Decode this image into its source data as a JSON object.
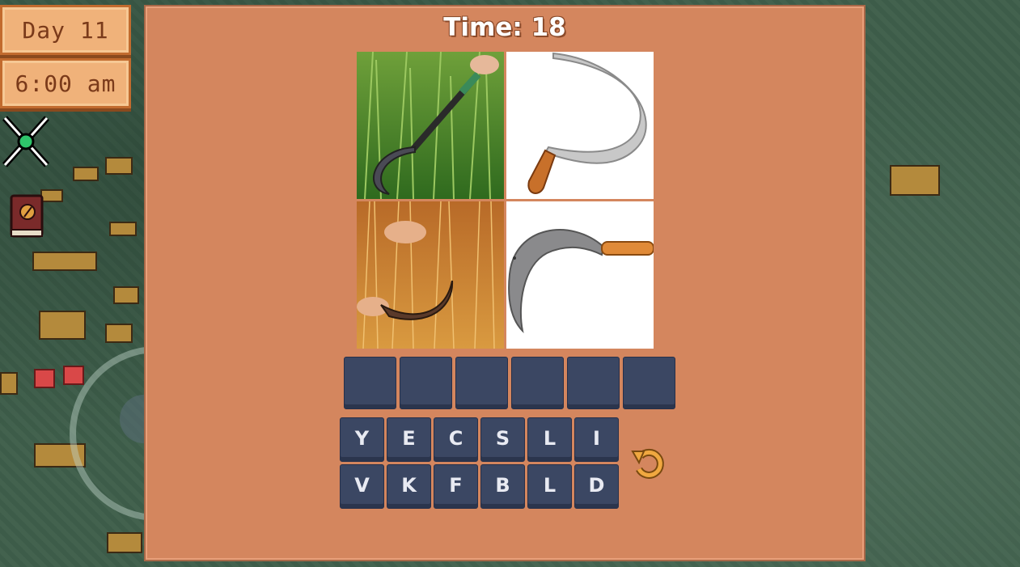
{
  "hud": {
    "day": "Day 11",
    "time": "6:00 am"
  },
  "puzzle": {
    "timer": "Time: 18",
    "answer_length": 6,
    "letters_row1": [
      "Y",
      "E",
      "C",
      "S",
      "L",
      "I"
    ],
    "letters_row2": [
      "V",
      "K",
      "F",
      "B",
      "L",
      "D"
    ]
  },
  "colors": {
    "panel": "#d4865e",
    "tile": "#3b4763",
    "hud_box": "#f0b27a",
    "grass": "#3f5f4b"
  },
  "icons": {
    "status": "crossed-swords-icon",
    "journal": "journal-book-icon",
    "reset": "undo-arrow-icon"
  }
}
